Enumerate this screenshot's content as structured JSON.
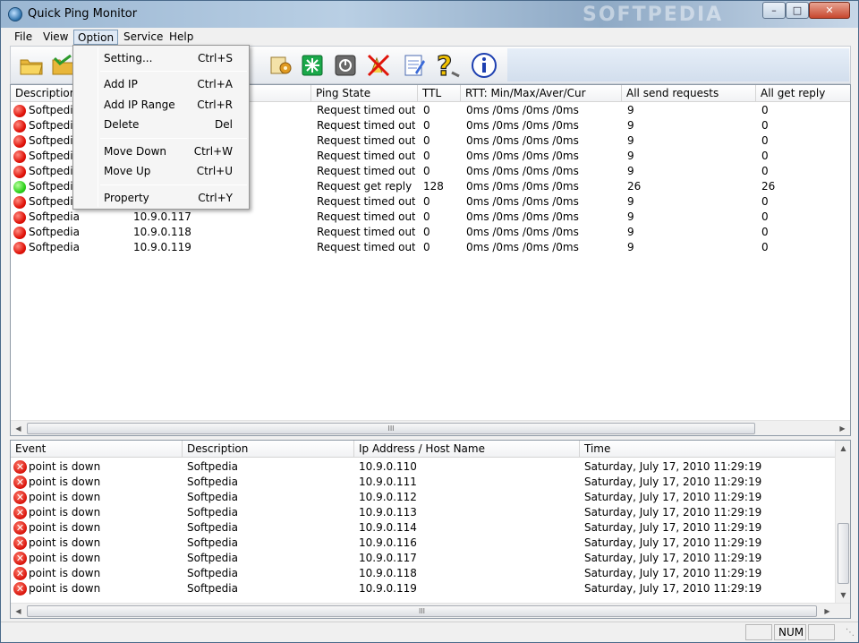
{
  "window": {
    "title": "Quick Ping Monitor",
    "watermark": "SOFTPEDIA"
  },
  "menubar": {
    "items": [
      "File",
      "View",
      "Option",
      "Service",
      "Help"
    ],
    "active": "Option"
  },
  "toolbar": {
    "buttons": [
      "open-folder-icon",
      "save-folder-icon",
      "settings-icon",
      "start-icon",
      "stop-icon",
      "clear-icon",
      "notes-icon",
      "help-icon",
      "info-icon"
    ]
  },
  "option_menu": {
    "items": [
      {
        "label": "Setting...",
        "shortcut": "Ctrl+S"
      },
      {
        "label": "Add IP",
        "shortcut": "Ctrl+A"
      },
      {
        "label": "Add IP Range",
        "shortcut": "Ctrl+R"
      },
      {
        "label": "Delete",
        "shortcut": "Del"
      },
      {
        "label": "Move Down",
        "shortcut": "Ctrl+W"
      },
      {
        "label": "Move Up",
        "shortcut": "Ctrl+U"
      },
      {
        "label": "Property",
        "shortcut": "Ctrl+Y"
      }
    ]
  },
  "hosts": {
    "columns": [
      "Description",
      "Ip Address",
      "Ping State",
      "TTL",
      "RTT: Min/Max/Aver/Cur",
      "All send requests",
      "All get reply"
    ],
    "rows": [
      {
        "status": "red",
        "description": "Softpedia",
        "ip": "",
        "state": "Request timed out",
        "ttl": "0",
        "rtt": "0ms /0ms /0ms /0ms",
        "sent": "9",
        "reply": "0"
      },
      {
        "status": "red",
        "description": "Softpedia",
        "ip": "",
        "state": "Request timed out",
        "ttl": "0",
        "rtt": "0ms /0ms /0ms /0ms",
        "sent": "9",
        "reply": "0"
      },
      {
        "status": "red",
        "description": "Softpedia",
        "ip": "",
        "state": "Request timed out",
        "ttl": "0",
        "rtt": "0ms /0ms /0ms /0ms",
        "sent": "9",
        "reply": "0"
      },
      {
        "status": "red",
        "description": "Softpedia",
        "ip": "",
        "state": "Request timed out",
        "ttl": "0",
        "rtt": "0ms /0ms /0ms /0ms",
        "sent": "9",
        "reply": "0"
      },
      {
        "status": "red",
        "description": "Softpedia",
        "ip": "",
        "state": "Request timed out",
        "ttl": "0",
        "rtt": "0ms /0ms /0ms /0ms",
        "sent": "9",
        "reply": "0"
      },
      {
        "status": "green",
        "description": "Softpedia",
        "ip": "",
        "state": "Request get reply",
        "ttl": "128",
        "rtt": "0ms /0ms /0ms /0ms",
        "sent": "26",
        "reply": "26"
      },
      {
        "status": "red",
        "description": "Softpedia",
        "ip": "",
        "state": "Request timed out",
        "ttl": "0",
        "rtt": "0ms /0ms /0ms /0ms",
        "sent": "9",
        "reply": "0"
      },
      {
        "status": "red",
        "description": "Softpedia",
        "ip": "10.9.0.117",
        "state": "Request timed out",
        "ttl": "0",
        "rtt": "0ms /0ms /0ms /0ms",
        "sent": "9",
        "reply": "0"
      },
      {
        "status": "red",
        "description": "Softpedia",
        "ip": "10.9.0.118",
        "state": "Request timed out",
        "ttl": "0",
        "rtt": "0ms /0ms /0ms /0ms",
        "sent": "9",
        "reply": "0"
      },
      {
        "status": "red",
        "description": "Softpedia",
        "ip": "10.9.0.119",
        "state": "Request timed out",
        "ttl": "0",
        "rtt": "0ms /0ms /0ms /0ms",
        "sent": "9",
        "reply": "0"
      }
    ]
  },
  "events": {
    "columns": [
      "Event",
      "Description",
      "Ip Address / Host Name",
      "Time"
    ],
    "rows": [
      {
        "event": "point is down",
        "description": "Softpedia",
        "ip": "10.9.0.110",
        "time": "Saturday, July 17, 2010  11:29:19"
      },
      {
        "event": "point is down",
        "description": "Softpedia",
        "ip": "10.9.0.111",
        "time": "Saturday, July 17, 2010  11:29:19"
      },
      {
        "event": "point is down",
        "description": "Softpedia",
        "ip": "10.9.0.112",
        "time": "Saturday, July 17, 2010  11:29:19"
      },
      {
        "event": "point is down",
        "description": "Softpedia",
        "ip": "10.9.0.113",
        "time": "Saturday, July 17, 2010  11:29:19"
      },
      {
        "event": "point is down",
        "description": "Softpedia",
        "ip": "10.9.0.114",
        "time": "Saturday, July 17, 2010  11:29:19"
      },
      {
        "event": "point is down",
        "description": "Softpedia",
        "ip": "10.9.0.116",
        "time": "Saturday, July 17, 2010  11:29:19"
      },
      {
        "event": "point is down",
        "description": "Softpedia",
        "ip": "10.9.0.117",
        "time": "Saturday, July 17, 2010  11:29:19"
      },
      {
        "event": "point is down",
        "description": "Softpedia",
        "ip": "10.9.0.118",
        "time": "Saturday, July 17, 2010  11:29:19"
      },
      {
        "event": "point is down",
        "description": "Softpedia",
        "ip": "10.9.0.119",
        "time": "Saturday, July 17, 2010  11:29:19"
      }
    ]
  },
  "scroll": {
    "grip": "III"
  },
  "statusbar": {
    "num": "NUM"
  },
  "colors": {
    "down": "#e0140a",
    "up": "#2ed11c"
  }
}
